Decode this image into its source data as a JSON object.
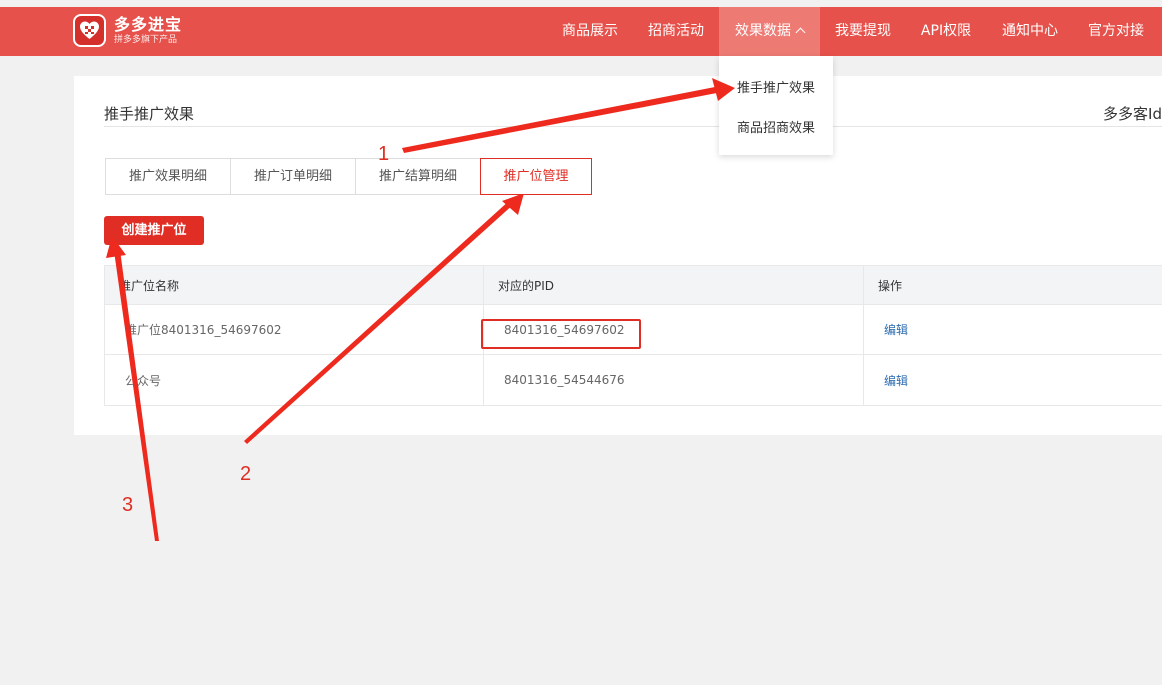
{
  "header": {
    "logo_title": "多多进宝",
    "logo_sub": "拼多多旗下产品",
    "nav": [
      {
        "label": "商品展示"
      },
      {
        "label": "招商活动"
      },
      {
        "label": "效果数据"
      },
      {
        "label": "我要提现"
      },
      {
        "label": "API权限"
      },
      {
        "label": "通知中心"
      },
      {
        "label": "官方对接"
      }
    ],
    "active_nav": "效果数据",
    "accent_color": "#e6524b"
  },
  "dropdown": {
    "items": [
      {
        "label": "推手推广效果"
      },
      {
        "label": "商品招商效果"
      }
    ]
  },
  "page": {
    "title": "推手推广效果",
    "right_text": "多多客Id"
  },
  "tabs": [
    {
      "label": "推广效果明细"
    },
    {
      "label": "推广订单明细"
    },
    {
      "label": "推广结算明细"
    },
    {
      "label": "推广位管理"
    }
  ],
  "active_tab": "推广位管理",
  "create_button": "创建推广位",
  "table": {
    "headers": [
      "推广位名称",
      "对应的PID",
      "操作"
    ],
    "rows": [
      {
        "name": "推广位8401316_54697602",
        "pid": "8401316_54697602",
        "action": "编辑"
      },
      {
        "name": "公众号",
        "pid": "8401316_54544676",
        "action": "编辑"
      }
    ]
  },
  "annotations": {
    "labels": [
      "1",
      "2",
      "3"
    ],
    "color": "#e02e24"
  }
}
